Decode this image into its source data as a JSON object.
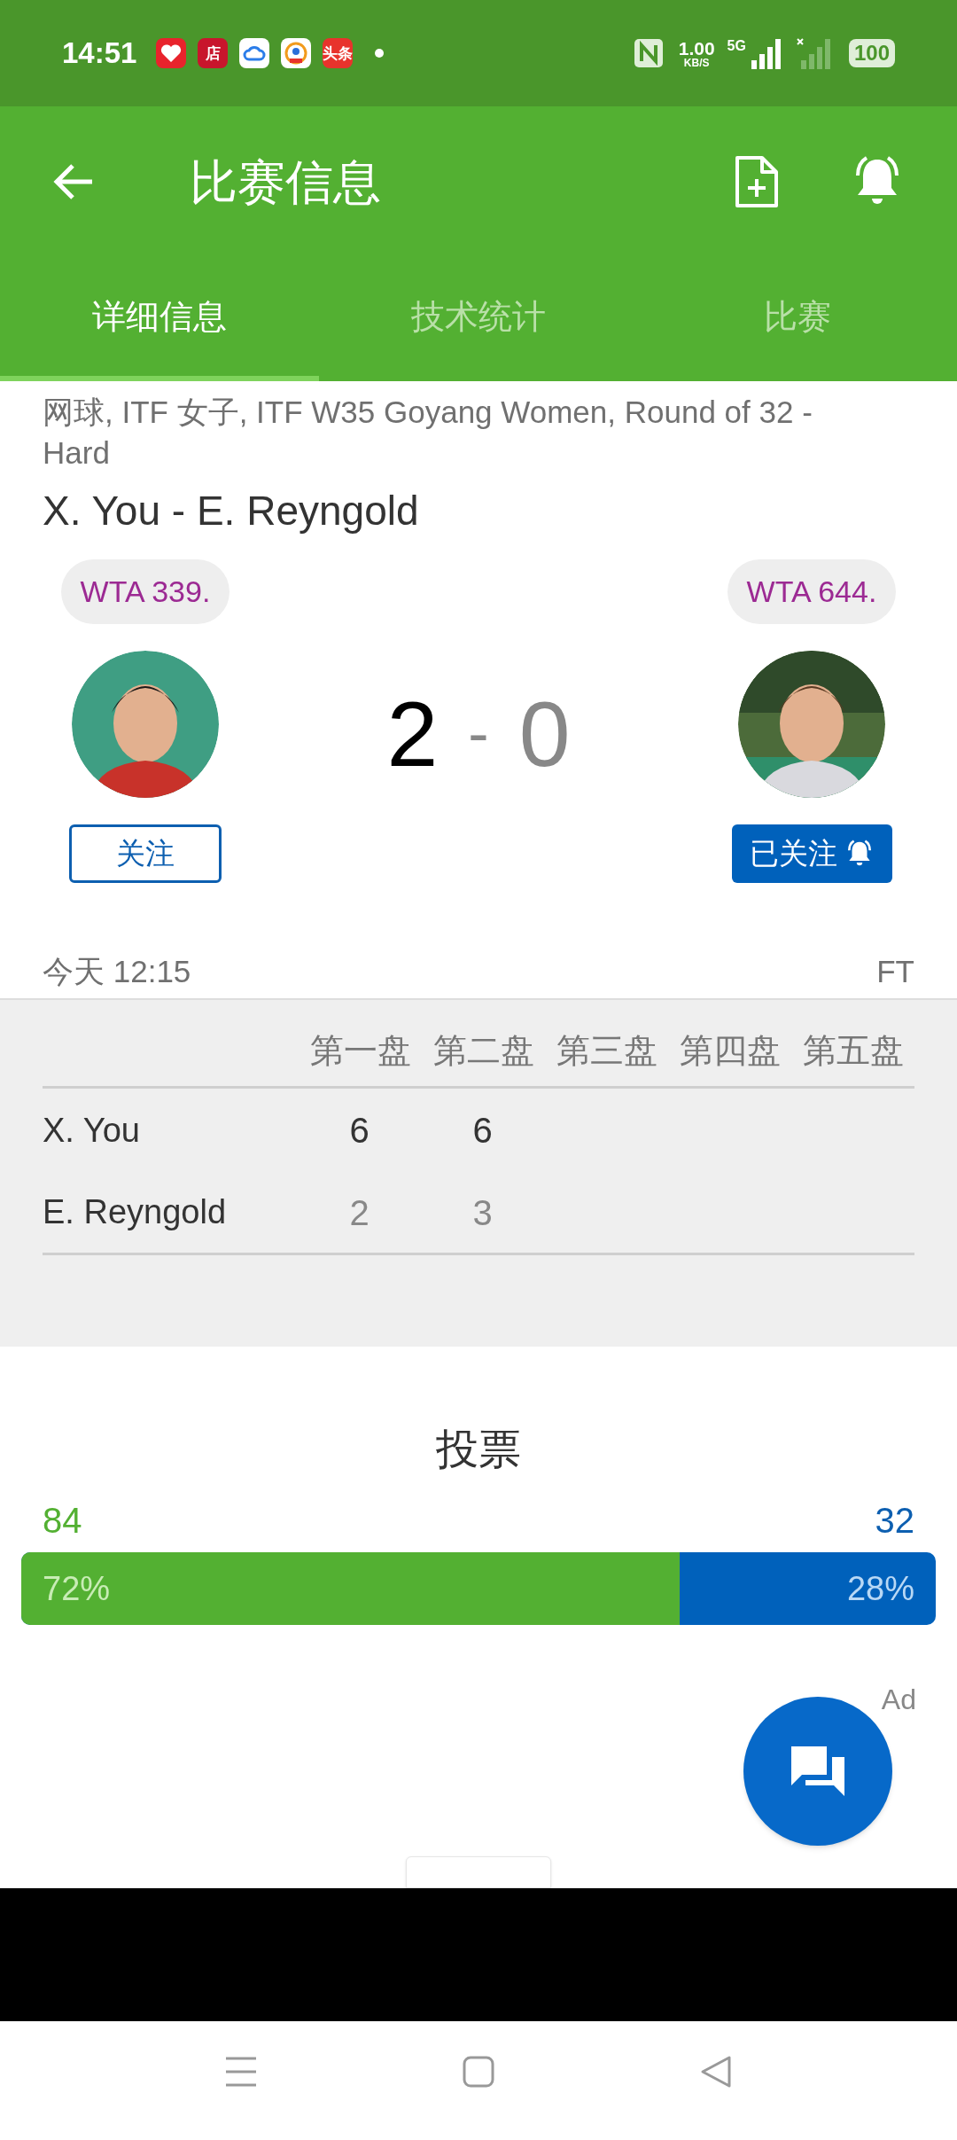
{
  "status_bar": {
    "time": "14:51",
    "notification_icons": [
      {
        "kind": "heart",
        "color": "#e8232c"
      },
      {
        "kind": "text",
        "text": "店",
        "color": "#c8152c"
      },
      {
        "kind": "cloud",
        "color": "#ffffff"
      },
      {
        "kind": "person",
        "color": "#ffffff"
      },
      {
        "kind": "text",
        "text": "头条",
        "color": "#e8332c"
      }
    ],
    "speed": "1.00",
    "speed_unit": "KB/S",
    "network": "5G",
    "battery": "100"
  },
  "header": {
    "title": "比赛信息"
  },
  "tabs": [
    {
      "label": "详细信息",
      "selected": true
    },
    {
      "label": "技术统计",
      "selected": false
    },
    {
      "label": "比赛",
      "selected": false
    }
  ],
  "match": {
    "category": "网球, ITF 女子, ITF W35 Goyang Women, Round of 32 - Hard",
    "title": "X. You - E. Reyngold",
    "players": [
      {
        "rank": "WTA 339.",
        "follow_label": "关注",
        "following": false,
        "winner": true,
        "score": "2"
      },
      {
        "rank": "WTA 644.",
        "follow_label": "已关注",
        "following": true,
        "winner": false,
        "score": "0"
      }
    ],
    "separator": "-",
    "time": "今天 12:15",
    "status": "FT"
  },
  "sets_table": {
    "columns": [
      "第一盘",
      "第二盘",
      "第三盘",
      "第四盘",
      "第五盘"
    ],
    "rows": [
      {
        "name": "X. You",
        "winner": true,
        "scores": [
          "6",
          "6"
        ]
      },
      {
        "name": "E. Reyngold",
        "winner": false,
        "scores": [
          "2",
          "3"
        ]
      }
    ]
  },
  "vote": {
    "title": "投票",
    "home_count": "84",
    "away_count": "32",
    "home_percent": "72%",
    "away_percent": "28%",
    "level": 0.72
  },
  "ad_label": "Ad"
}
